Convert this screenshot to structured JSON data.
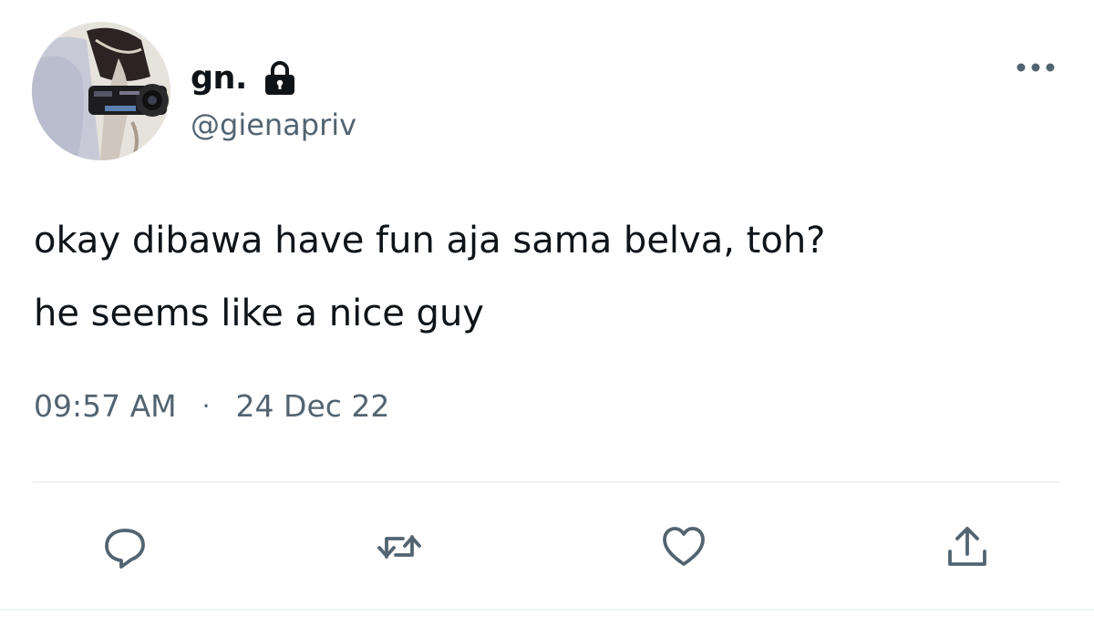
{
  "tweet": {
    "display_name": "gn.",
    "username": "@gienapriv",
    "text_lines": [
      "okay dibawa have fun aja sama belva, toh?",
      "he seems like a nice guy"
    ],
    "time": "09:57 AM",
    "separator": "·",
    "date": "24 Dec 22"
  },
  "icons": {
    "lock": "lock-icon",
    "more": "more-horizontal-icon",
    "reply": "reply-icon",
    "retweet": "retweet-icon",
    "like": "heart-icon",
    "share": "share-icon"
  },
  "colors": {
    "text": "#0f1419",
    "secondary": "#536471",
    "divider": "#eff3f4"
  }
}
